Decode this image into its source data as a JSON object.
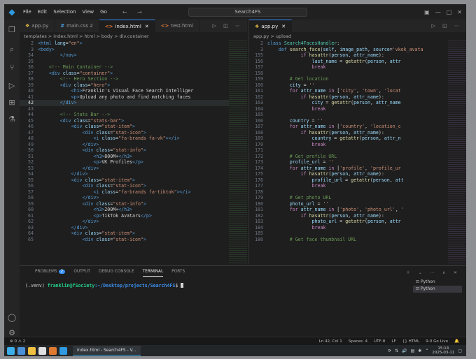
{
  "window": {
    "menu": [
      "File",
      "Edit",
      "Selection",
      "View",
      "Go"
    ],
    "search": "Search4FS",
    "nav_arrows": "← →"
  },
  "left_editor": {
    "tabs": [
      {
        "label": "app.py",
        "kind": "py",
        "active": false
      },
      {
        "label": "main.css 2",
        "kind": "css",
        "active": false
      },
      {
        "label": "index.html",
        "kind": "html",
        "active": true
      },
      {
        "label": "test.html",
        "kind": "html",
        "active": false
      }
    ],
    "breadcrumb": "templates > index.html > html > body > div.container",
    "cursor_line": "42",
    "lines": [
      {
        "n": "2",
        "h": "<span class='tg'>&lt;html</span> <span class='at'>lang</span>=<span class='st'>\"en\"</span><span class='tg'>&gt;</span>"
      },
      {
        "n": "3",
        "h": "<span class='tg'>&lt;body&gt;</span>"
      },
      {
        "n": "34",
        "h": "        <span class='tg'>&lt;/nav&gt;</span>"
      },
      {
        "n": "35",
        "h": ""
      },
      {
        "n": "36",
        "h": "    <span class='cm'>&lt;!-- Main Container --&gt;</span>"
      },
      {
        "n": "37",
        "h": "    <span class='tg'>&lt;div</span> <span class='at'>class</span>=<span class='st'>\"container\"</span><span class='tg'>&gt;</span>"
      },
      {
        "n": "38",
        "h": "        <span class='cm'>&lt;!-- Hero Section --&gt;</span>"
      },
      {
        "n": "39",
        "h": "        <span class='tg'>&lt;div</span> <span class='at'>class</span>=<span class='st'>\"hero\"</span><span class='tg'>&gt;</span>"
      },
      {
        "n": "40",
        "h": "            <span class='tg'>&lt;h1&gt;</span>Franklin's Visual Face Search Intelliger"
      },
      {
        "n": "41",
        "h": "            <span class='tg'>&lt;p&gt;</span>Upload any photo and find matching faces"
      },
      {
        "n": "42",
        "h": "        <span class='tg'>&lt;/div&gt;</span>"
      },
      {
        "n": "43",
        "h": ""
      },
      {
        "n": "44",
        "h": "        <span class='cm'>&lt;!-- Stats Bar --&gt;</span>"
      },
      {
        "n": "45",
        "h": "        <span class='tg'>&lt;div</span> <span class='at'>class</span>=<span class='st'>\"stats-bar\"</span><span class='tg'>&gt;</span>"
      },
      {
        "n": "46",
        "h": "            <span class='tg'>&lt;div</span> <span class='at'>class</span>=<span class='st'>\"stat-item\"</span><span class='tg'>&gt;</span>"
      },
      {
        "n": "47",
        "h": "                <span class='tg'>&lt;div</span> <span class='at'>class</span>=<span class='st'>\"stat-icon\"</span><span class='tg'>&gt;</span>"
      },
      {
        "n": "48",
        "h": "                    <span class='tg'>&lt;i</span> <span class='at'>class</span>=<span class='st'>\"fa-brands fa-vk\"</span><span class='tg'>&gt;&lt;/i&gt;</span>"
      },
      {
        "n": "49",
        "h": "                <span class='tg'>&lt;/div&gt;</span>"
      },
      {
        "n": "50",
        "h": "                <span class='tg'>&lt;div</span> <span class='at'>class</span>=<span class='st'>\"stat-info\"</span><span class='tg'>&gt;</span>"
      },
      {
        "n": "51",
        "h": "                    <span class='tg'>&lt;h3&gt;</span>800M+<span class='tg'>&lt;/h3&gt;</span>"
      },
      {
        "n": "52",
        "h": "                    <span class='tg'>&lt;p&gt;</span>VK Profiles<span class='tg'>&lt;/p&gt;</span>"
      },
      {
        "n": "53",
        "h": "                <span class='tg'>&lt;/div&gt;</span>"
      },
      {
        "n": "54",
        "h": "            <span class='tg'>&lt;/div&gt;</span>"
      },
      {
        "n": "55",
        "h": "            <span class='tg'>&lt;div</span> <span class='at'>class</span>=<span class='st'>\"stat-item\"</span><span class='tg'>&gt;</span>"
      },
      {
        "n": "56",
        "h": "                <span class='tg'>&lt;div</span> <span class='at'>class</span>=<span class='st'>\"stat-icon\"</span><span class='tg'>&gt;</span>"
      },
      {
        "n": "57",
        "h": "                    <span class='tg'>&lt;i</span> <span class='at'>class</span>=<span class='st'>\"fa-brands fa-tiktok\"</span><span class='tg'>&gt;&lt;/i&gt;</span>"
      },
      {
        "n": "58",
        "h": "                <span class='tg'>&lt;/div&gt;</span>"
      },
      {
        "n": "59",
        "h": "                <span class='tg'>&lt;div</span> <span class='at'>class</span>=<span class='st'>\"stat-info\"</span><span class='tg'>&gt;</span>"
      },
      {
        "n": "60",
        "h": "                    <span class='tg'>&lt;h3&gt;</span>200M+<span class='tg'>&lt;/h3&gt;</span>"
      },
      {
        "n": "61",
        "h": "                    <span class='tg'>&lt;p&gt;</span>TikTok Avatars<span class='tg'>&lt;/p&gt;</span>"
      },
      {
        "n": "62",
        "h": "                <span class='tg'>&lt;/div&gt;</span>"
      },
      {
        "n": "63",
        "h": "            <span class='tg'>&lt;/div&gt;</span>"
      },
      {
        "n": "64",
        "h": "            <span class='tg'>&lt;div</span> <span class='at'>class</span>=<span class='st'>\"stat-item\"</span><span class='tg'>&gt;</span>"
      },
      {
        "n": "65",
        "h": "                <span class='tg'>&lt;div</span> <span class='at'>class</span>=<span class='st'>\"stat-icon\"</span><span class='tg'>&gt;</span>"
      }
    ]
  },
  "right_editor": {
    "tabs": [
      {
        "label": "app.py",
        "kind": "py",
        "active": true
      }
    ],
    "breadcrumb": "app.py > upload",
    "lines": [
      {
        "n": "2",
        "h": "<span class='kwb'>class</span> <span class='cl'>Search4FacesHandler</span>:"
      },
      {
        "n": "3",
        "h": "    <span class='kwb'>def</span> <span class='fn'>search_face</span>(<span class='var'>self</span>, <span class='var'>image_path</span>, <span class='var'>source</span>=<span class='st'>'vkok_avata</span>"
      },
      {
        "n": "155",
        "h": "            <span class='kw'>if</span> <span class='fn'>hasattr</span>(<span class='var'>person</span>, <span class='var'>attr_name</span>):"
      },
      {
        "n": "156",
        "h": "                <span class='var'>last_name</span> = <span class='fn'>getattr</span>(<span class='var'>person</span>, <span class='var'>attr</span>"
      },
      {
        "n": "157",
        "h": "                <span class='kw'>break</span>"
      },
      {
        "n": "158",
        "h": ""
      },
      {
        "n": "159",
        "h": "        <span class='cm'># Get location</span>"
      },
      {
        "n": "160",
        "h": "        <span class='var'>city</span> = <span class='st'>''</span>"
      },
      {
        "n": "161",
        "h": "        <span class='kw'>for</span> <span class='var'>attr_name</span> <span class='kw'>in</span> [<span class='st'>'city'</span>, <span class='st'>'town'</span>, <span class='st'>'locat</span>"
      },
      {
        "n": "162",
        "h": "            <span class='kw'>if</span> <span class='fn'>hasattr</span>(<span class='var'>person</span>, <span class='var'>attr_name</span>):"
      },
      {
        "n": "163",
        "h": "                <span class='var'>city</span> = <span class='fn'>getattr</span>(<span class='var'>person</span>, <span class='var'>attr_name</span>"
      },
      {
        "n": "164",
        "h": "                <span class='kw'>break</span>"
      },
      {
        "n": "165",
        "h": ""
      },
      {
        "n": "166",
        "h": "        <span class='var'>country</span> = <span class='st'>''</span>"
      },
      {
        "n": "167",
        "h": "        <span class='kw'>for</span> <span class='var'>attr_name</span> <span class='kw'>in</span> [<span class='st'>'country'</span>, <span class='st'>'location_c</span>"
      },
      {
        "n": "168",
        "h": "            <span class='kw'>if</span> <span class='fn'>hasattr</span>(<span class='var'>person</span>, <span class='var'>attr_name</span>):"
      },
      {
        "n": "169",
        "h": "                <span class='var'>country</span> = <span class='fn'>getattr</span>(<span class='var'>person</span>, <span class='var'>attr_n</span>"
      },
      {
        "n": "170",
        "h": "                <span class='kw'>break</span>"
      },
      {
        "n": "171",
        "h": ""
      },
      {
        "n": "172",
        "h": "        <span class='cm'># Get profile URL</span>"
      },
      {
        "n": "173",
        "h": "        <span class='var'>profile_url</span> = <span class='st'>''</span>"
      },
      {
        "n": "174",
        "h": "        <span class='kw'>for</span> <span class='var'>attr_name</span> <span class='kw'>in</span> [<span class='st'>'profile'</span>, <span class='st'>'profile_ur</span>"
      },
      {
        "n": "175",
        "h": "            <span class='kw'>if</span> <span class='fn'>hasattr</span>(<span class='var'>person</span>, <span class='var'>attr_name</span>):"
      },
      {
        "n": "176",
        "h": "                <span class='var'>profile_url</span> = <span class='fn'>getattr</span>(<span class='var'>person</span>, <span class='var'>att</span>"
      },
      {
        "n": "177",
        "h": "                <span class='kw'>break</span>"
      },
      {
        "n": "178",
        "h": ""
      },
      {
        "n": "179",
        "h": "        <span class='cm'># Get photo URL</span>"
      },
      {
        "n": "180",
        "h": "        <span class='var'>photo_url</span> = <span class='st'>''</span>"
      },
      {
        "n": "181",
        "h": "        <span class='kw'>for</span> <span class='var'>attr_name</span> <span class='kw'>in</span> [<span class='st'>'photo'</span>, <span class='st'>'photo_url'</span>, <span class='st'>'</span>"
      },
      {
        "n": "182",
        "h": "            <span class='kw'>if</span> <span class='fn'>hasattr</span>(<span class='var'>person</span>, <span class='var'>attr_name</span>):"
      },
      {
        "n": "183",
        "h": "                <span class='var'>photo_url</span> = <span class='fn'>getattr</span>(<span class='var'>person</span>, <span class='var'>attr</span>"
      },
      {
        "n": "184",
        "h": "                <span class='kw'>break</span>"
      },
      {
        "n": "185",
        "h": ""
      },
      {
        "n": "186",
        "h": "        <span class='cm'># Get face thumbnail URL</span>"
      }
    ]
  },
  "panel": {
    "tabs": [
      "PROBLEMS",
      "OUTPUT",
      "DEBUG CONSOLE",
      "TERMINAL",
      "PORTS"
    ],
    "problems_count": "2",
    "active_tab": "TERMINAL",
    "prompt_prefix": "(.venv) ",
    "prompt_user": "franklin@fSociety",
    "prompt_path": ":~/Desktop/projects/Search4FS",
    "prompt_symbol": "$ ",
    "terminals": [
      "Python",
      "Python"
    ]
  },
  "status_bar": {
    "left": [
      "⊗ 0 ⚠ 2"
    ],
    "right": [
      "Ln 42, Col 1",
      "Spaces: 4",
      "UTF-8",
      "LF",
      "{} HTML",
      "9-0 Go Live"
    ]
  },
  "taskbar": {
    "window_title": "index.html - Search4FS - V...",
    "time": "15:14",
    "date": "2025-03-11"
  },
  "colors": {
    "accent": "#3794ff",
    "panel_badge": "#3794ff",
    "terminal_user": "#23d18b",
    "terminal_path": "#3b8eea"
  }
}
